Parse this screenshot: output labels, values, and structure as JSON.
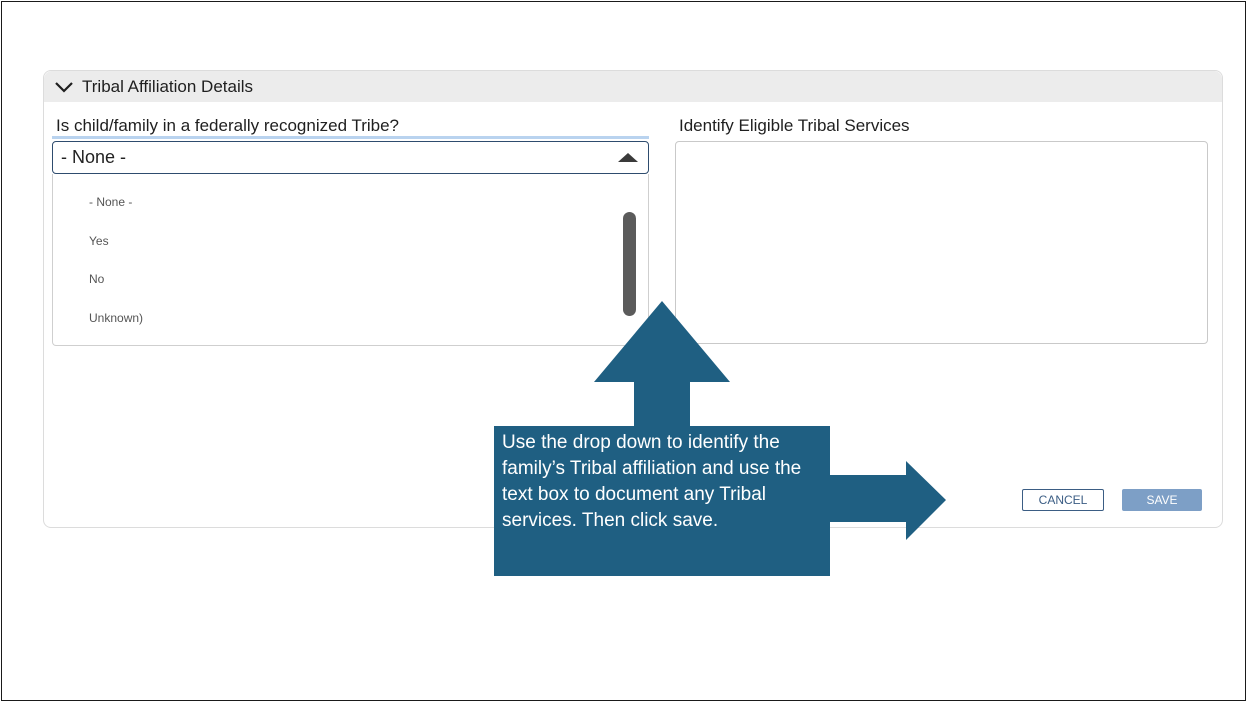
{
  "section": {
    "title": "Tribal Affiliation Details",
    "toggle_icon": "chevron-down-icon"
  },
  "tribe_question": {
    "label": "Is child/family in a federally recognized Tribe?",
    "selected_value": "- None -",
    "options": [
      "- None -",
      "Yes",
      "No",
      "Unknown)"
    ]
  },
  "services": {
    "label": "Identify Eligible Tribal Services",
    "value": ""
  },
  "actions": {
    "cancel_label": "CANCEL",
    "save_label": "SAVE"
  },
  "callout": {
    "text": "Use the drop down to identify the family’s Tribal affiliation and use the text box to document any Tribal services. Then click save."
  },
  "colors": {
    "callout": "#1f5f82",
    "save_button": "#7d9fc6",
    "cancel_border": "#3b5d84"
  }
}
